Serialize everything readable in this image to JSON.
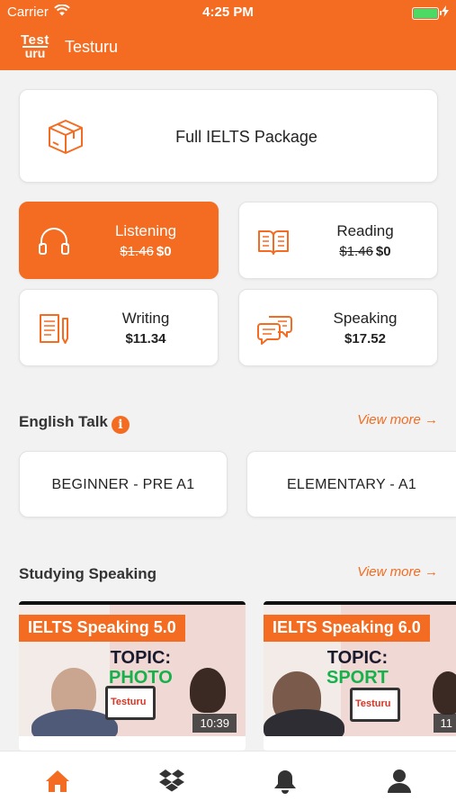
{
  "status_bar": {
    "carrier": "Carrier",
    "time": "4:25 PM"
  },
  "header": {
    "logo_line1": "Test",
    "logo_line2": "uru",
    "title": "Testuru"
  },
  "full_package": {
    "label": "Full IELTS Package",
    "icon": "package-box-icon"
  },
  "skills": [
    {
      "name": "Listening",
      "old_price": "$1.46",
      "price": "$0",
      "icon": "headphones-icon",
      "active": true
    },
    {
      "name": "Reading",
      "old_price": "$1.46",
      "price": "$0",
      "icon": "open-book-icon",
      "active": false
    },
    {
      "name": "Writing",
      "old_price": "",
      "price": "$11.34",
      "icon": "document-pencil-icon",
      "active": false
    },
    {
      "name": "Speaking",
      "old_price": "",
      "price": "$17.52",
      "icon": "speech-bubbles-icon",
      "active": false
    }
  ],
  "english_talk": {
    "title": "English Talk",
    "info_glyph": "i",
    "view_more": "View more →",
    "levels": [
      "BEGINNER - PRE A1",
      "ELEMENTARY - A1"
    ]
  },
  "studying_speaking": {
    "title": "Studying Speaking",
    "view_more": "View more →",
    "videos": [
      {
        "banner": "IELTS Speaking 5.0",
        "topic_label": "TOPIC:",
        "topic": "PHOTO",
        "laptop_text": "Testuru",
        "duration": "10:39"
      },
      {
        "banner": "IELTS Speaking 6.0",
        "topic_label": "TOPIC:",
        "topic": "SPORT",
        "laptop_text": "Testuru",
        "duration": "11"
      }
    ]
  },
  "tab_bar": {
    "items": [
      {
        "name": "home",
        "icon": "home-icon",
        "active": true
      },
      {
        "name": "packages",
        "icon": "dropbox-icon",
        "active": false
      },
      {
        "name": "notifications",
        "icon": "bell-icon",
        "active": false
      },
      {
        "name": "profile",
        "icon": "user-icon",
        "active": false
      }
    ]
  },
  "colors": {
    "accent": "#f36c21",
    "background": "#f2f2f2",
    "battery": "#4cd964",
    "topic_green": "#15b24b"
  }
}
